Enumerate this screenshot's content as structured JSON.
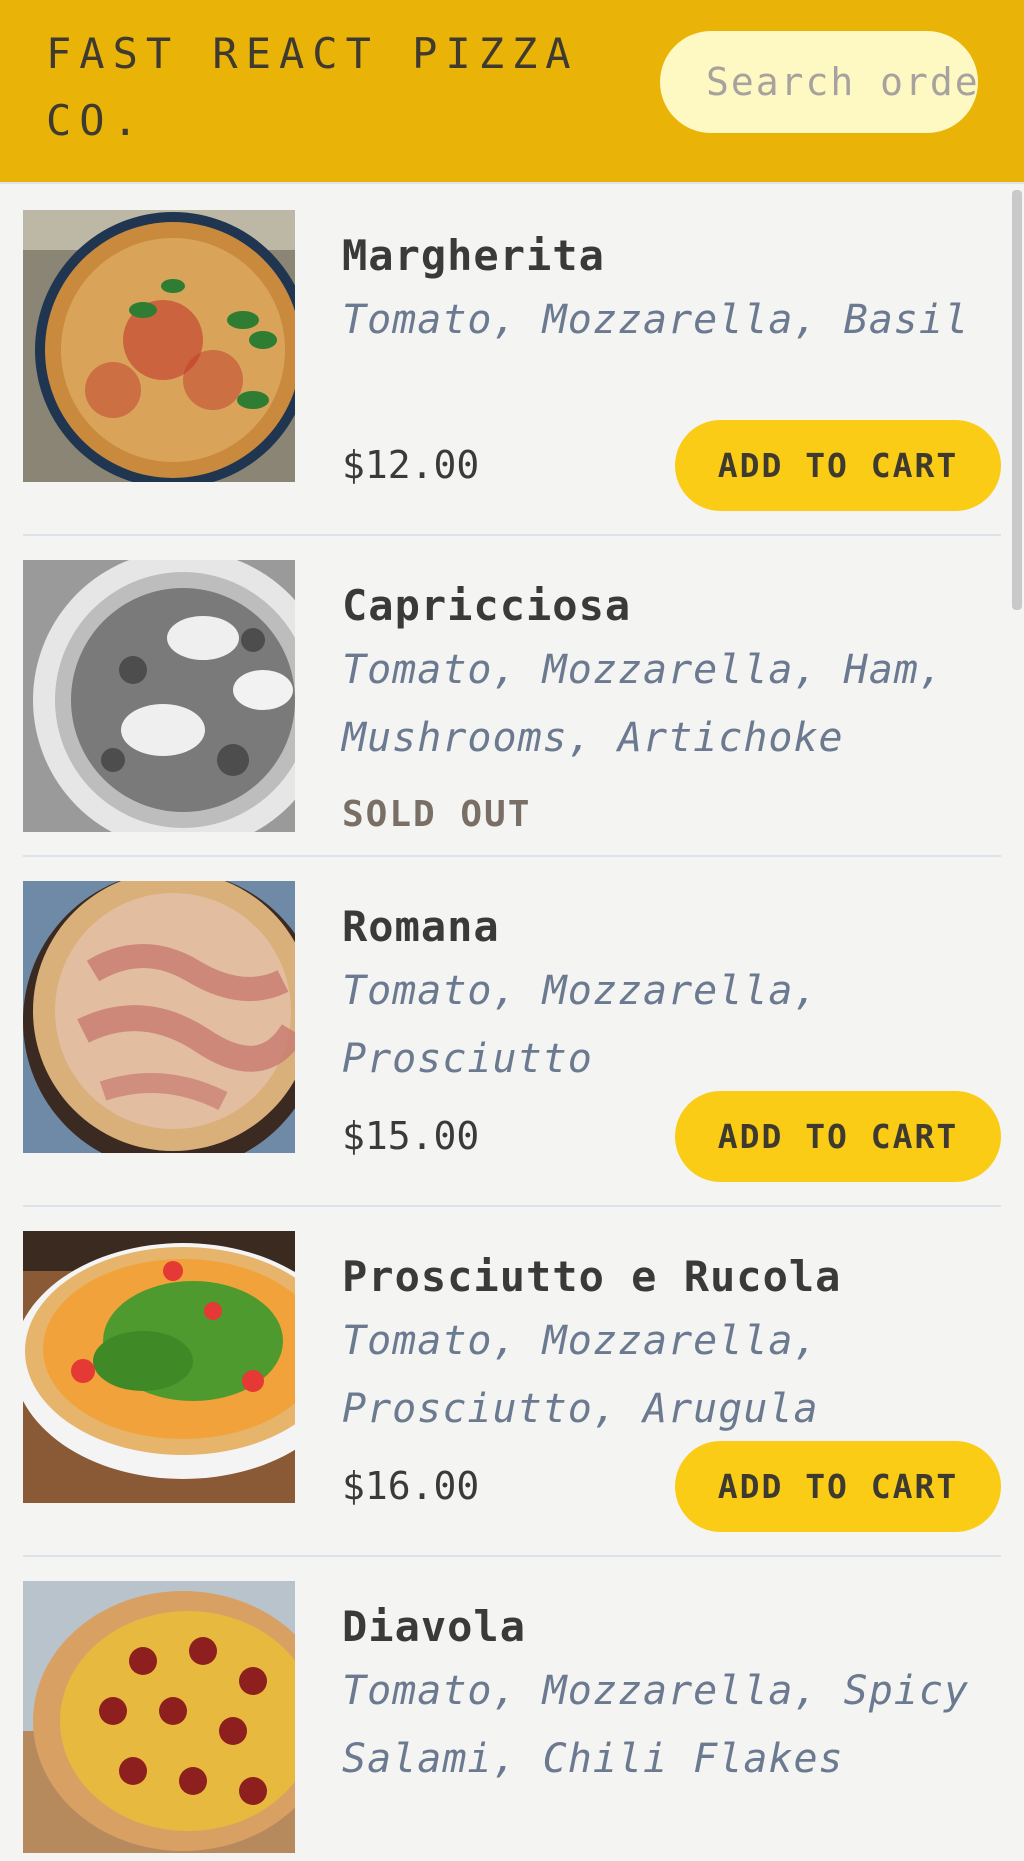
{
  "header": {
    "title": "FAST REACT PIZZA CO.",
    "search_placeholder": "Search order #"
  },
  "menu": {
    "items": [
      {
        "name": "Margherita",
        "ingredients": "Tomato, Mozzarella, Basil",
        "price": "$12.00",
        "sold_out": false,
        "button": "ADD TO CART"
      },
      {
        "name": "Capricciosa",
        "ingredients": "Tomato, Mozzarella, Ham, Mushrooms, Artichoke",
        "status": "SOLD OUT",
        "sold_out": true
      },
      {
        "name": "Romana",
        "ingredients": "Tomato, Mozzarella, Prosciutto",
        "price": "$15.00",
        "sold_out": false,
        "button": "ADD TO CART"
      },
      {
        "name": "Prosciutto e Rucola",
        "ingredients": "Tomato, Mozzarella, Prosciutto, Arugula",
        "price": "$16.00",
        "sold_out": false,
        "button": "ADD TO CART"
      },
      {
        "name": "Diavola",
        "ingredients": "Tomato, Mozzarella, Spicy Salami, Chili Flakes",
        "sold_out": false
      }
    ]
  },
  "colors": {
    "header_bg": "#eab308",
    "button_bg": "#facc15",
    "ingredients_text": "#6b7a90",
    "page_bg": "#f4f4f2"
  }
}
